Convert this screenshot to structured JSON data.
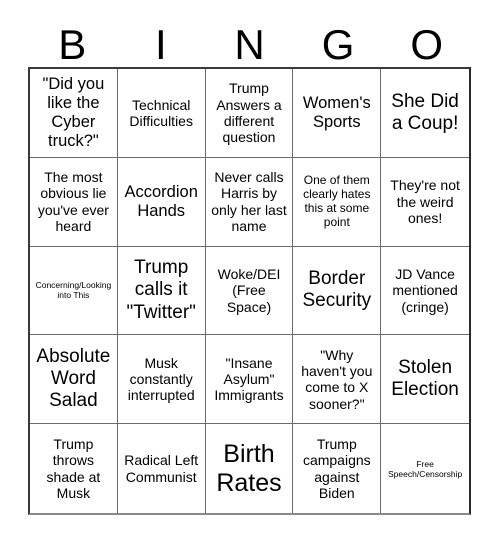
{
  "card": {
    "title": "BINGO",
    "header_letters": [
      "B",
      "I",
      "N",
      "G",
      "O"
    ],
    "columns": 5,
    "rows": 5,
    "background_color": "#ffffff",
    "text_color": "#000000",
    "grid_line_color": "#6b6b6b",
    "outer_border_color": "#2b2b2b",
    "free_space_cell": "Woke/DEI (Free Space)",
    "cells": [
      {
        "text": "\"Did you like the Cyber truck?\"",
        "size": "sz-lg",
        "row": 1,
        "col": 1,
        "column_letter": "B"
      },
      {
        "text": "Technical Difficulties",
        "size": "sz-md",
        "row": 1,
        "col": 2,
        "column_letter": "I"
      },
      {
        "text": "Trump Answers a different question",
        "size": "sz-md",
        "row": 1,
        "col": 3,
        "column_letter": "N"
      },
      {
        "text": "Women's Sports",
        "size": "sz-lg",
        "row": 1,
        "col": 4,
        "column_letter": "G"
      },
      {
        "text": "She Did a Coup!",
        "size": "sz-xl",
        "row": 1,
        "col": 5,
        "column_letter": "O"
      },
      {
        "text": "The most obvious lie you've ever heard",
        "size": "sz-md",
        "row": 2,
        "col": 1,
        "column_letter": "B"
      },
      {
        "text": "Accordion Hands",
        "size": "sz-lg",
        "row": 2,
        "col": 2,
        "column_letter": "I"
      },
      {
        "text": "Never calls Harris by only her last name",
        "size": "sz-md",
        "row": 2,
        "col": 3,
        "column_letter": "N"
      },
      {
        "text": "One of them clearly hates this at some point",
        "size": "sz-sm",
        "row": 2,
        "col": 4,
        "column_letter": "G"
      },
      {
        "text": "They're not the weird ones!",
        "size": "sz-md",
        "row": 2,
        "col": 5,
        "column_letter": "O"
      },
      {
        "text": "Concerning/Looking into This",
        "size": "sz-xs",
        "row": 3,
        "col": 1,
        "column_letter": "B"
      },
      {
        "text": "Trump calls it \"Twitter\"",
        "size": "sz-xl",
        "row": 3,
        "col": 2,
        "column_letter": "I"
      },
      {
        "text": "Woke/DEI (Free Space)",
        "size": "sz-md",
        "row": 3,
        "col": 3,
        "column_letter": "N"
      },
      {
        "text": "Border Security",
        "size": "sz-xl",
        "row": 3,
        "col": 4,
        "column_letter": "G"
      },
      {
        "text": "JD Vance mentioned (cringe)",
        "size": "sz-md",
        "row": 3,
        "col": 5,
        "column_letter": "O"
      },
      {
        "text": "Absolute Word Salad",
        "size": "sz-xl",
        "row": 4,
        "col": 1,
        "column_letter": "B"
      },
      {
        "text": "Musk constantly interrupted",
        "size": "sz-md",
        "row": 4,
        "col": 2,
        "column_letter": "I"
      },
      {
        "text": "\"Insane Asylum\" Immigrants",
        "size": "sz-md",
        "row": 4,
        "col": 3,
        "column_letter": "N"
      },
      {
        "text": "\"Why haven't you come to X sooner?\"",
        "size": "sz-md",
        "row": 4,
        "col": 4,
        "column_letter": "G"
      },
      {
        "text": "Stolen Election",
        "size": "sz-xl",
        "row": 4,
        "col": 5,
        "column_letter": "O"
      },
      {
        "text": "Trump throws shade at Musk",
        "size": "sz-md",
        "row": 5,
        "col": 1,
        "column_letter": "B"
      },
      {
        "text": "Radical Left Communist",
        "size": "sz-md",
        "row": 5,
        "col": 2,
        "column_letter": "I"
      },
      {
        "text": "Birth Rates",
        "size": "sz-xxl",
        "row": 5,
        "col": 3,
        "column_letter": "N"
      },
      {
        "text": "Trump campaigns against Biden",
        "size": "sz-md",
        "row": 5,
        "col": 4,
        "column_letter": "G"
      },
      {
        "text": "Free Speech/Censorship",
        "size": "sz-xs",
        "row": 5,
        "col": 5,
        "column_letter": "O"
      }
    ]
  }
}
